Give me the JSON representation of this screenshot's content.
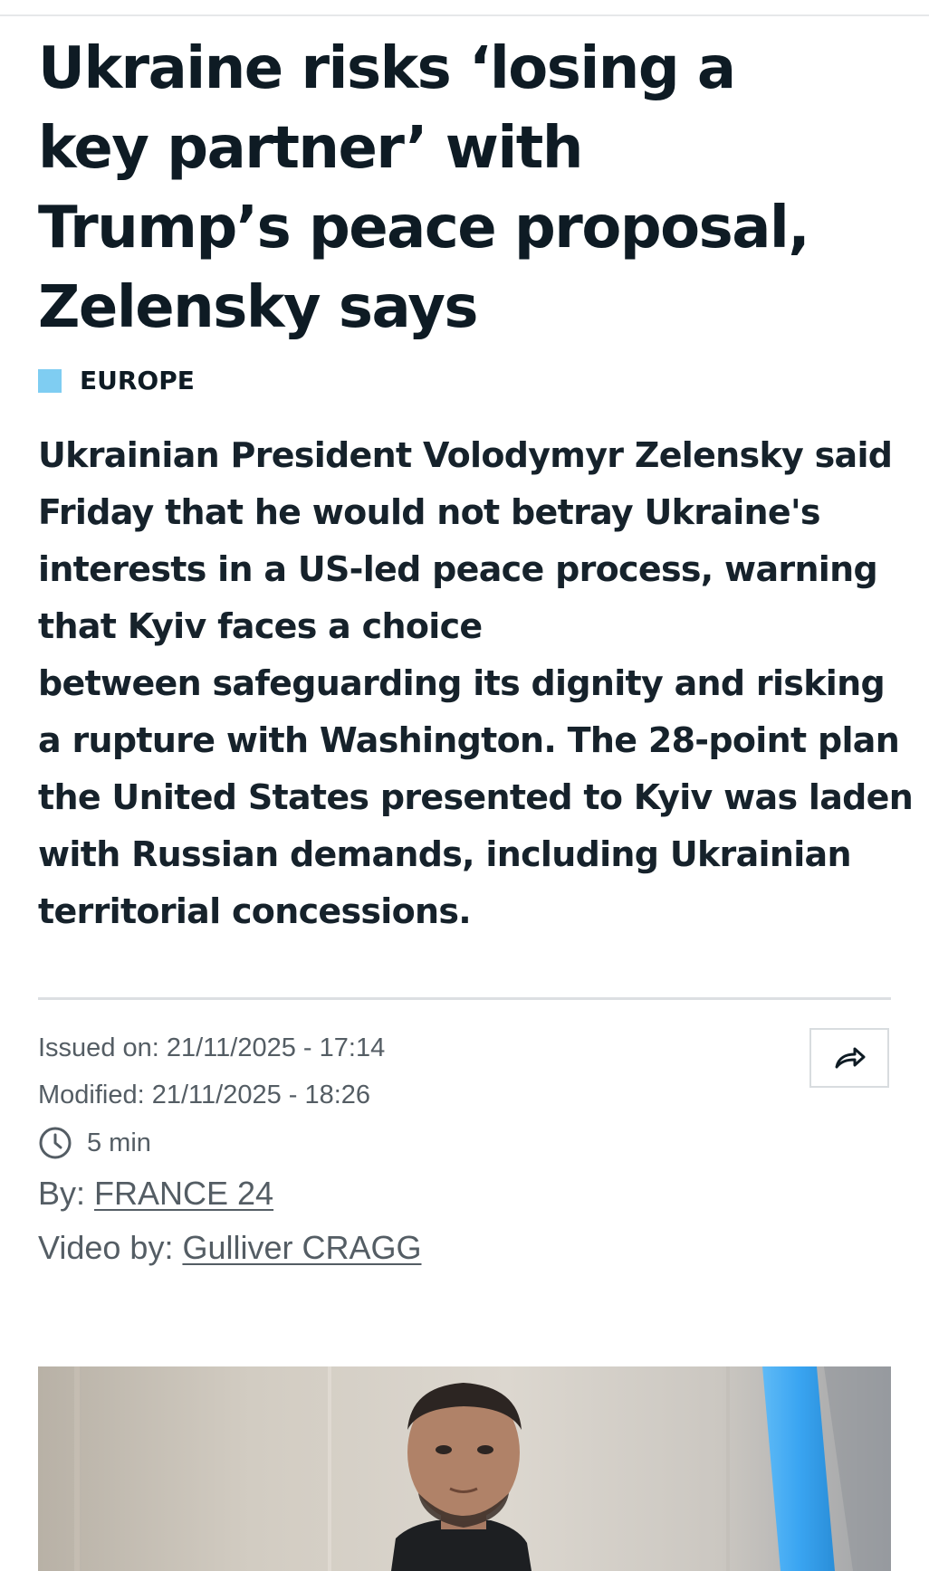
{
  "article": {
    "headline_lines": [
      "Ukraine risks ‘losing a",
      "key partner’ with",
      "Trump’s peace proposal,",
      "Zelensky says"
    ],
    "category": "EUROPE",
    "lede_lines": [
      "Ukrainian President Volodymyr Zelensky said",
      "Friday that he would not betray Ukraine's",
      "interests in a US-led peace process, warning",
      "that Kyiv faces a choice",
      "between safeguarding its dignity and risking",
      "a rupture with Washington. The 28-point plan",
      "the United States presented to Kyiv was laden",
      "with Russian demands, including Ukrainian",
      "territorial concessions."
    ]
  },
  "meta": {
    "issued": "Issued on: 21/11/2025 - 17:14",
    "modified": "Modified: 21/11/2025 - 18:26",
    "read_time": "5 min",
    "by_label": "By: ",
    "by_author": "FRANCE 24",
    "video_label": "Video by: ",
    "video_author": "Gulliver CRAGG"
  },
  "icons": {
    "share": "share-arrow-icon",
    "clock": "clock-icon"
  },
  "colors": {
    "category_accent": "#7fcdf2",
    "headline": "#0e1b24",
    "meta_text": "#545d64",
    "flag_blue": "#3fa9f5"
  }
}
